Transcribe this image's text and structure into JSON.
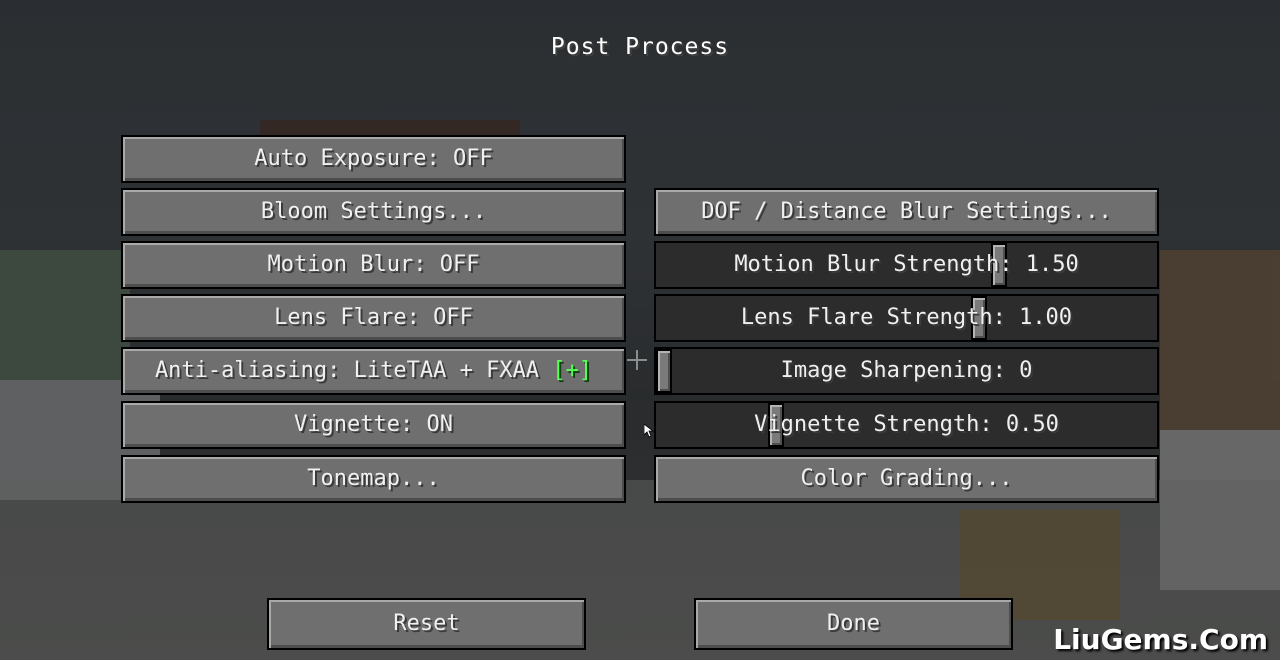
{
  "screen": {
    "title": "Post Process"
  },
  "left_column": [
    {
      "label": "Auto Exposure: OFF"
    },
    {
      "label": "Bloom Settings..."
    },
    {
      "label": "Motion Blur: OFF"
    },
    {
      "label": "Lens Flare: OFF"
    },
    {
      "label": "Anti-aliasing: LiteTAA + FXAA ",
      "suffix": "[+]"
    },
    {
      "label": "Vignette: ON"
    },
    {
      "label": "Tonemap..."
    }
  ],
  "right_column": {
    "dof_button": "DOF / Distance Blur Settings...",
    "sliders": [
      {
        "label": "Motion Blur Strength: 1.50",
        "level": 0.69
      },
      {
        "label": "Lens Flare Strength: 1.00",
        "level": 0.65
      },
      {
        "label": "Image Sharpening: 0",
        "level": 0.0
      },
      {
        "label": "Vignette Strength: 0.50",
        "level": 0.23
      }
    ],
    "color_grading_button": "Color Grading..."
  },
  "footer": {
    "reset_label": "Reset",
    "done_label": "Done"
  },
  "watermark": "LiuGems.Com",
  "colors": {
    "accent_green": "#55ff55",
    "button_gray": "#6f6f6f",
    "slider_track": "#2c2c2c"
  }
}
